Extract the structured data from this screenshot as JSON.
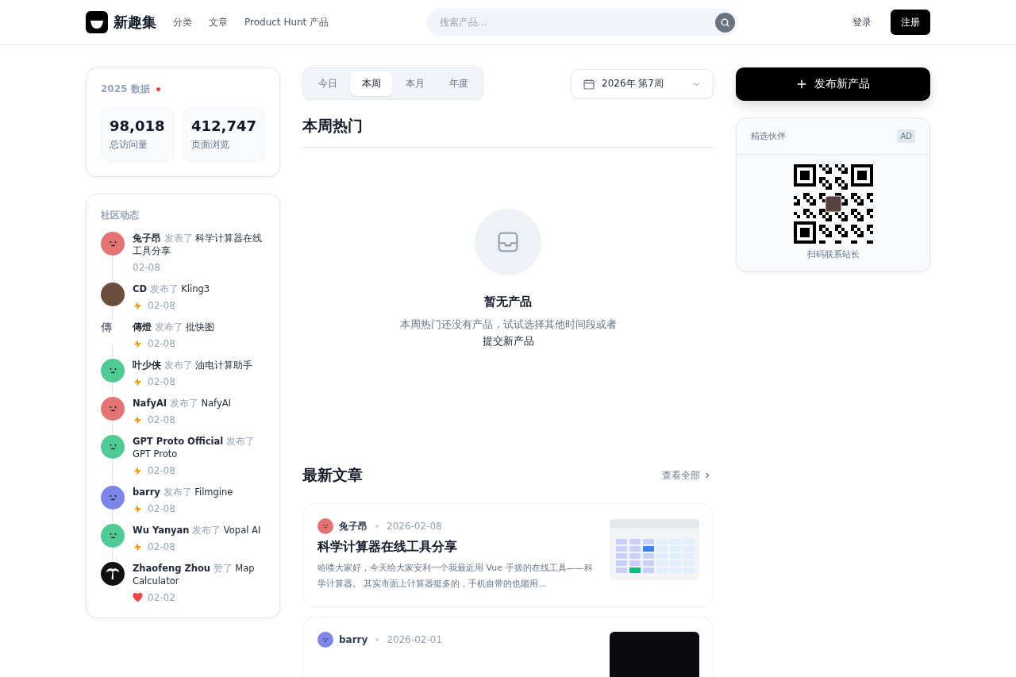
{
  "header": {
    "logo": "新趣集",
    "nav": [
      {
        "label": "分类"
      },
      {
        "label": "文章"
      },
      {
        "label": "Product Hunt 产品"
      }
    ],
    "search": {
      "placeholder": "搜索产品..."
    },
    "login": "登录",
    "register": "注册"
  },
  "stats": {
    "title": "2025 数据",
    "items": [
      {
        "value": "98,018",
        "label": "总访问量"
      },
      {
        "value": "412,747",
        "label": "页面浏览"
      }
    ]
  },
  "activity": {
    "title": "社区动态",
    "items": [
      {
        "user": "兔子昂",
        "action": "发表了",
        "target": "科学计算器在线工具分享",
        "date": "02-08",
        "kind": "plain",
        "avatar": {
          "kind": "face",
          "color": "#e57373"
        }
      },
      {
        "user": "CD",
        "action": "发布了",
        "target": "Kling3",
        "date": "02-08",
        "kind": "bolt",
        "avatar": {
          "kind": "photo"
        }
      },
      {
        "user": "傳燈",
        "action": "发布了",
        "target": "批快图",
        "date": "02-08",
        "kind": "bolt",
        "avatar": {
          "kind": "broken",
          "alt": "傳"
        }
      },
      {
        "user": "叶少侠",
        "action": "发布了",
        "target": "油电计算助手",
        "date": "02-08",
        "kind": "bolt",
        "avatar": {
          "kind": "face",
          "color": "#4ecb94"
        }
      },
      {
        "user": "NafyAI",
        "action": "发布了",
        "target": "NafyAI",
        "date": "02-08",
        "kind": "bolt",
        "avatar": {
          "kind": "face",
          "color": "#e57373"
        }
      },
      {
        "user": "GPT Proto Official",
        "action": "发布了",
        "target": "GPT Proto",
        "date": "02-08",
        "kind": "bolt",
        "avatar": {
          "kind": "face",
          "color": "#4ecb94"
        }
      },
      {
        "user": "barry",
        "action": "发布了",
        "target": "Filmgine",
        "date": "02-08",
        "kind": "bolt",
        "avatar": {
          "kind": "face",
          "color": "#7c86e8"
        }
      },
      {
        "user": "Wu Yanyan",
        "action": "发布了",
        "target": "Vopal AI",
        "date": "02-08",
        "kind": "bolt",
        "avatar": {
          "kind": "face",
          "color": "#4ecb94"
        }
      },
      {
        "user": "Zhaofeng Zhou",
        "action": "赞了",
        "target": "Map Calculator",
        "date": "02-02",
        "kind": "heart",
        "avatar": {
          "kind": "palm"
        }
      }
    ]
  },
  "periods": [
    {
      "label": "今日",
      "selected": false
    },
    {
      "label": "本周",
      "selected": true
    },
    {
      "label": "本月",
      "selected": false
    },
    {
      "label": "年度",
      "selected": false
    }
  ],
  "week_picker": "2026年 第7周",
  "section_title": "本周热门",
  "empty": {
    "title": "暂无产品",
    "text": "本周热门还没有产品，试试选择其他时间段或者",
    "link": "提交新产品"
  },
  "articles": {
    "title": "最新文章",
    "view_all": "查看全部",
    "items": [
      {
        "author": "兔子昂",
        "date": "2026-02-08",
        "title": "科学计算器在线工具分享",
        "excerpt": "哈喽大家好，今天给大家安利一个我最近用 Vue 手搓的在线工具——科学计算器。 其实市面上计算器挺多的，手机自带的也能用...",
        "avatar": {
          "color": "#e57373"
        },
        "kind": "calculator"
      },
      {
        "author": "barry",
        "date": "2026-02-01",
        "avatar": {
          "color": "#7c86e8"
        },
        "kind": "photo"
      }
    ]
  },
  "publish_button": "发布新产品",
  "partner": {
    "title": "精选伙伴",
    "badge": "AD",
    "caption": "扫码联系站长"
  }
}
